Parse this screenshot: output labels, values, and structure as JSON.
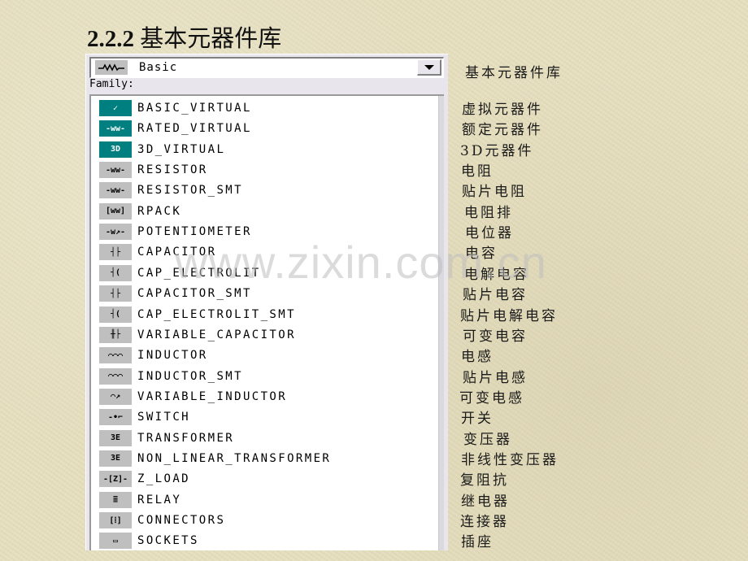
{
  "title": {
    "number": "2.2.2",
    "text": "基本元器件库"
  },
  "combo": {
    "icon": "resistor-wave-icon",
    "icon_glyph": "∿∿∿",
    "value": "Basic",
    "annotation": "基本元器件库"
  },
  "family_label": "Family:",
  "families": [
    {
      "name": "BASIC_VIRTUAL",
      "icon": "basic-virtual-icon",
      "glyph": "✓",
      "teal": true,
      "cn": "虚拟元器件"
    },
    {
      "name": "RATED_VIRTUAL",
      "icon": "rated-virtual-icon",
      "glyph": "-ww-",
      "teal": true,
      "cn": "额定元器件"
    },
    {
      "name": "3D_VIRTUAL",
      "icon": "3d-virtual-icon",
      "glyph": "3D",
      "teal": true,
      "cn": "3D元器件"
    },
    {
      "name": "RESISTOR",
      "icon": "resistor-icon",
      "glyph": "-ww-",
      "teal": false,
      "cn": "电阻"
    },
    {
      "name": "RESISTOR_SMT",
      "icon": "resistor-smt-icon",
      "glyph": "-ww-",
      "teal": false,
      "cn": "贴片电阻"
    },
    {
      "name": "RPACK",
      "icon": "rpack-icon",
      "glyph": "[ww]",
      "teal": false,
      "cn": "电阻排"
    },
    {
      "name": "POTENTIOMETER",
      "icon": "potentiometer-icon",
      "glyph": "-w↗-",
      "teal": false,
      "cn": "电位器"
    },
    {
      "name": "CAPACITOR",
      "icon": "capacitor-icon",
      "glyph": "┤├",
      "teal": false,
      "cn": "电容"
    },
    {
      "name": "CAP_ELECTROLIT",
      "icon": "cap-electrolit-icon",
      "glyph": "┤(",
      "teal": false,
      "cn": "电解电容"
    },
    {
      "name": "CAPACITOR_SMT",
      "icon": "capacitor-smt-icon",
      "glyph": "┤├",
      "teal": false,
      "cn": "贴片电容"
    },
    {
      "name": "CAP_ELECTROLIT_SMT",
      "icon": "cap-electrolit-smt-icon",
      "glyph": "┤(",
      "teal": false,
      "cn": "贴片电解电容"
    },
    {
      "name": "VARIABLE_CAPACITOR",
      "icon": "variable-capacitor-icon",
      "glyph": "╫├",
      "teal": false,
      "cn": "可变电容"
    },
    {
      "name": "INDUCTOR",
      "icon": "inductor-icon",
      "glyph": "⌒⌒⌒",
      "teal": false,
      "cn": "电感"
    },
    {
      "name": "INDUCTOR_SMT",
      "icon": "inductor-smt-icon",
      "glyph": "⌒⌒⌒",
      "teal": false,
      "cn": "贴片电感"
    },
    {
      "name": "VARIABLE_INDUCTOR",
      "icon": "variable-inductor-icon",
      "glyph": "⌒↗",
      "teal": false,
      "cn": "可变电感"
    },
    {
      "name": "SWITCH",
      "icon": "switch-icon",
      "glyph": "-•⌐",
      "teal": false,
      "cn": "开关"
    },
    {
      "name": "TRANSFORMER",
      "icon": "transformer-icon",
      "glyph": "3E",
      "teal": false,
      "cn": "变压器"
    },
    {
      "name": "NON_LINEAR_TRANSFORMER",
      "icon": "non-linear-transformer-icon",
      "glyph": "3E",
      "teal": false,
      "cn": "非线性变压器"
    },
    {
      "name": "Z_LOAD",
      "icon": "z-load-icon",
      "glyph": "-[Z]-",
      "teal": false,
      "cn": "复阻抗"
    },
    {
      "name": "RELAY",
      "icon": "relay-icon",
      "glyph": "≣",
      "teal": false,
      "cn": "继电器"
    },
    {
      "name": "CONNECTORS",
      "icon": "connectors-icon",
      "glyph": "[⁞]",
      "teal": false,
      "cn": "连接器"
    },
    {
      "name": "SOCKETS",
      "icon": "sockets-icon",
      "glyph": "▭",
      "teal": false,
      "cn": "插座"
    }
  ],
  "watermark": "www.zixin.com.cn"
}
